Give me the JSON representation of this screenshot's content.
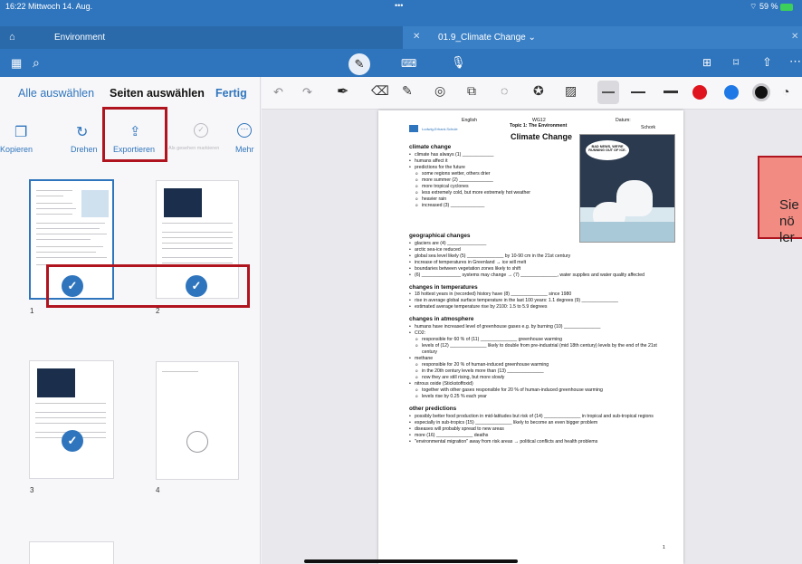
{
  "status": {
    "time": "16:22",
    "date": "Mittwoch 14. Aug.",
    "battery": "59 %"
  },
  "tabs": {
    "left_title": "Environment",
    "right_title": "01.9_Climate Change"
  },
  "sidebar": {
    "select_all": "Alle auswählen",
    "title": "Seiten auswählen",
    "done": "Fertig",
    "actions": [
      {
        "label": "Kopieren"
      },
      {
        "label": "Drehen"
      },
      {
        "label": "Exportieren"
      },
      {
        "label": "Als gesehen markieren"
      },
      {
        "label": "Mehr"
      }
    ],
    "pages": [
      "1",
      "2",
      "3",
      "4"
    ]
  },
  "document": {
    "header_left": "English",
    "header_mid": "WG12",
    "header_right": "Datum:",
    "school": "Ludwig-Erhard-Schule",
    "topic": "Topic 1: The Environment",
    "right_name": "Schork",
    "title": "Climate Change",
    "cartoon_text": "BAD NEWS, WE'RE RUNNING OUT OF ICE.",
    "s1": "climate change",
    "s1_items": [
      "climate has always (1) ____________",
      "humans affect it",
      "predictions for the future"
    ],
    "s1_sub": [
      "some regions wetter, others drier",
      "more summer (2) _____________",
      "more tropical cyclones",
      "less extremely cold, but more extremely hot weather",
      "heavier rain",
      "increased (3) _____________"
    ],
    "s2": "geographical changes",
    "s2_items": [
      "glaciers are (4) _______________",
      "arctic sea-ice reduced",
      "global sea level likely (5) ______________ by 10-90 cm in the 21st century",
      "increase of temperatures in Greenland → ice will melt",
      "boundaries between vegetation zones likely to shift",
      "(6) _______________ systems may change → (7) ______________, water supplies and water quality affected"
    ],
    "s3": "changes in temperatures",
    "s3_items": [
      "18 hottest years in (recorded) history have (8) ______________ since 1980",
      "rise in average global surface temperature in the last 100 years: 1.1 degrees (9) ______________",
      "estimated average temperature rise by 2100: 1.5 to 5.9 degrees"
    ],
    "s4": "changes in atmosphere",
    "s4_items": [
      "humans have increased level of greenhouse gases e.g. by burning (10) ______________",
      "CO2:"
    ],
    "s4_sub": [
      "responsible for 60 % of (11) ______________ greenhouse warming",
      "levels of (12) ______________ likely to double from pre-industrial (mid 18th century) levels by the end of the 21st century"
    ],
    "s4_items2": [
      "methane"
    ],
    "s4_sub2": [
      "responsible for 20 % of human-induced greenhouse warming",
      "in the 20th century levels more than (13) ______________",
      "now they are still rising, but more slowly"
    ],
    "s4_items3": [
      "nitrous oxide (Stickstoffoxid)"
    ],
    "s4_sub3": [
      "together with other gases responsible for 20 % of human-induced greenhouse warming",
      "levels rise by 0.25 % each year"
    ],
    "s5": "other predictions",
    "s5_items": [
      "possibly better food production in mid-latitudes but risk of (14) ______________ in tropical and sub-tropical regions",
      "especially in sub-tropics (15) ______________ likely to become an even bigger problem",
      "diseases will probably spread to new areas",
      "more (16) ______________ deaths",
      "\"environmental migration\" away from risk areas → political conflicts and health problems"
    ],
    "page_no": "1"
  },
  "note": {
    "lines": [
      "Sie",
      "nö",
      "ler"
    ]
  },
  "colors": {
    "accent": "#2f75bd",
    "red_box": "#b0141e",
    "note_bg": "#f28b82"
  }
}
